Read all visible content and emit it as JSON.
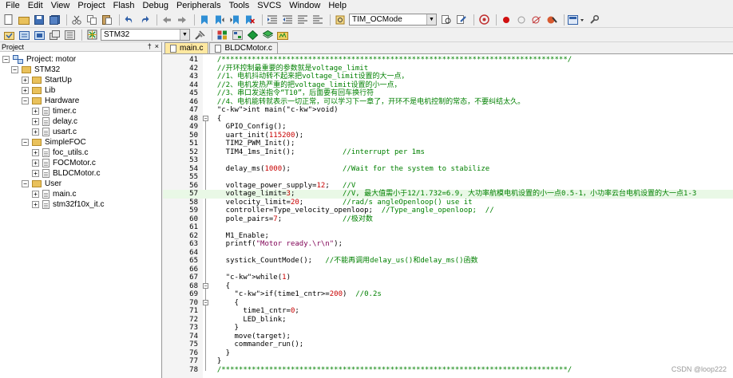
{
  "menu": [
    "File",
    "Edit",
    "View",
    "Project",
    "Flash",
    "Debug",
    "Peripherals",
    "Tools",
    "SVCS",
    "Window",
    "Help"
  ],
  "toolbar": {
    "target_combo": "TIM_OCMode",
    "build_target": "STM32"
  },
  "project": {
    "title": "Project",
    "pin": "†",
    "close": "×",
    "root": "Project: motor",
    "target": "STM32",
    "groups": [
      {
        "name": "StartUp",
        "files": []
      },
      {
        "name": "Lib",
        "files": []
      },
      {
        "name": "Hardware",
        "files": [
          "timer.c",
          "delay.c",
          "usart.c"
        ]
      },
      {
        "name": "SimpleFOC",
        "files": [
          "foc_utils.c",
          "FOCMotor.c",
          "BLDCMotor.c"
        ]
      },
      {
        "name": "User",
        "files": [
          "main.c",
          "stm32f10x_it.c"
        ]
      }
    ]
  },
  "tabs": [
    {
      "label": "main.c",
      "active": true
    },
    {
      "label": "BLDCMotor.c",
      "active": false
    }
  ],
  "code": [
    {
      "n": "41",
      "text": "  /********************************************************************************/",
      "cls": "c-cm"
    },
    {
      "n": "42",
      "text": "  //开环控制最重要的参数就是voltage_limit",
      "cls": "c-cm"
    },
    {
      "n": "43",
      "text": "  //1、电机抖动转不起来把voltage_limit设置的大一点，",
      "cls": "c-cm"
    },
    {
      "n": "44",
      "text": "  //2、电机发热严重的把voltage_limit设置的小一点，",
      "cls": "c-cm"
    },
    {
      "n": "45",
      "text": "  //3、串口发送指令“T10”，后面要有回车换行符",
      "cls": "c-cm"
    },
    {
      "n": "46",
      "text": "  //4、电机能转就表示一切正常，可以学习下一章了，开环不是电机控制的常态，不要纠结太久。",
      "cls": "c-cm"
    },
    {
      "n": "47",
      "text": "  int main(void)",
      "cls": ""
    },
    {
      "n": "48",
      "text": "  {",
      "cls": ""
    },
    {
      "n": "49",
      "text": "    GPIO_Config();",
      "cls": ""
    },
    {
      "n": "50",
      "text": "    uart_init(115200);",
      "cls": ""
    },
    {
      "n": "51",
      "text": "    TIM2_PWM_Init();",
      "cls": ""
    },
    {
      "n": "52",
      "text": "    TIM4_1ms_Init();           //interrupt per 1ms",
      "cls": ""
    },
    {
      "n": "53",
      "text": "",
      "cls": ""
    },
    {
      "n": "54",
      "text": "    delay_ms(1000);            //Wait for the system to stabilize",
      "cls": ""
    },
    {
      "n": "55",
      "text": "",
      "cls": ""
    },
    {
      "n": "56",
      "text": "    voltage_power_supply=12;   //V",
      "cls": ""
    },
    {
      "n": "57",
      "text": "    voltage_limit=3;           //V, 最大值需小于12/1.732=6.9, 大功率航模电机设置的小一点0.5-1，小功率云台电机设置的大一点1-3",
      "cls": ""
    },
    {
      "n": "58",
      "text": "    velocity_limit=20;         //rad/s angleOpenloop() use it",
      "cls": ""
    },
    {
      "n": "59",
      "text": "    controller=Type_velocity_openloop;  //Type_angle_openloop;  //",
      "cls": ""
    },
    {
      "n": "60",
      "text": "    pole_pairs=7;              //极对数",
      "cls": ""
    },
    {
      "n": "61",
      "text": "",
      "cls": ""
    },
    {
      "n": "62",
      "text": "    M1_Enable;",
      "cls": ""
    },
    {
      "n": "63",
      "text": "    printf(\"Motor ready.\\r\\n\");",
      "cls": ""
    },
    {
      "n": "64",
      "text": "",
      "cls": ""
    },
    {
      "n": "65",
      "text": "    systick_CountMode();   //不能再调用delay_us()和delay_ms()函数",
      "cls": ""
    },
    {
      "n": "66",
      "text": "",
      "cls": ""
    },
    {
      "n": "67",
      "text": "    while(1)",
      "cls": ""
    },
    {
      "n": "68",
      "text": "    {",
      "cls": ""
    },
    {
      "n": "69",
      "text": "      if(time1_cntr>=200)  //0.2s",
      "cls": ""
    },
    {
      "n": "70",
      "text": "      {",
      "cls": ""
    },
    {
      "n": "71",
      "text": "        time1_cntr=0;",
      "cls": ""
    },
    {
      "n": "72",
      "text": "        LED_blink;",
      "cls": ""
    },
    {
      "n": "73",
      "text": "      }",
      "cls": ""
    },
    {
      "n": "74",
      "text": "      move(target);",
      "cls": ""
    },
    {
      "n": "75",
      "text": "      commander_run();",
      "cls": ""
    },
    {
      "n": "76",
      "text": "    }",
      "cls": ""
    },
    {
      "n": "77",
      "text": "  }",
      "cls": ""
    },
    {
      "n": "78",
      "text": "  /********************************************************************************/",
      "cls": "c-cm"
    }
  ],
  "watermark": "CSDN @loop222"
}
